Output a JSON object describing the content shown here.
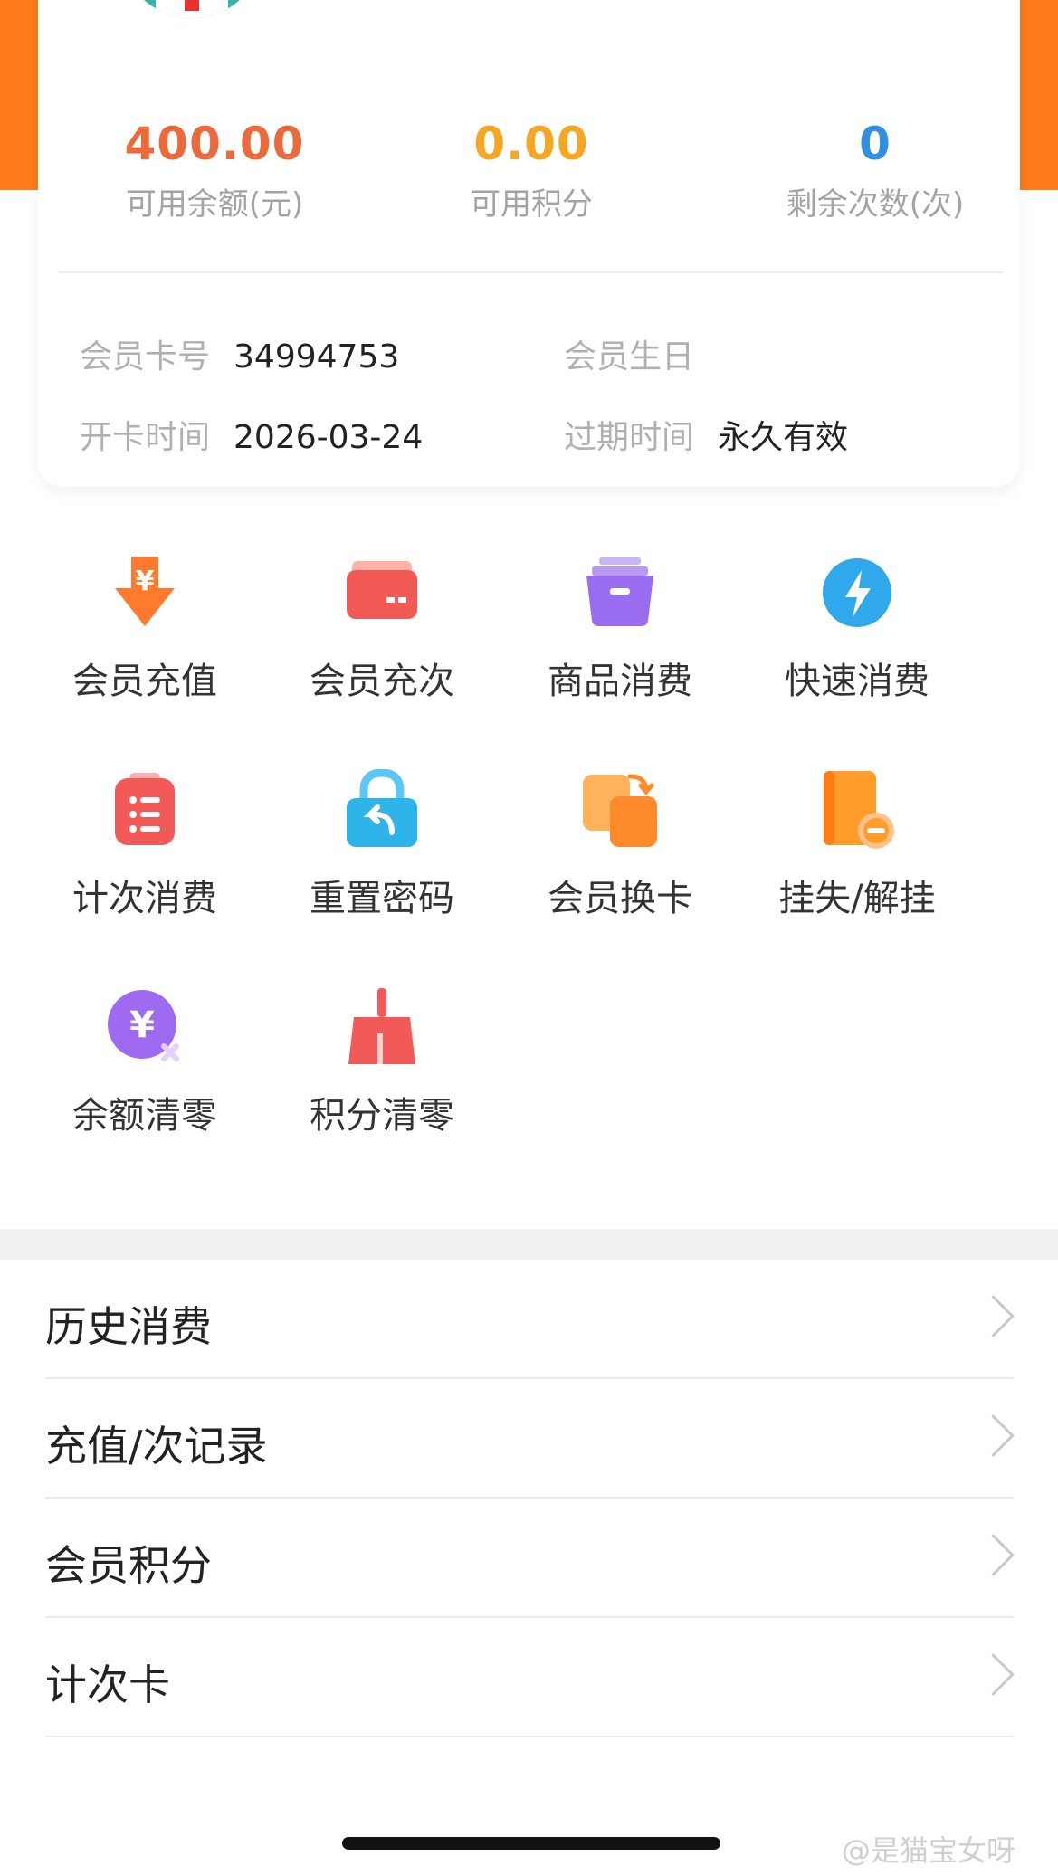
{
  "stats": {
    "balance": {
      "value": "400.00",
      "label": "可用余额(元)"
    },
    "points": {
      "value": "0.00",
      "label": "可用积分"
    },
    "remaining": {
      "value": "0",
      "label": "剩余次数(次)"
    }
  },
  "member_info": {
    "card_no_label": "会员卡号",
    "card_no": "34994753",
    "birthday_label": "会员生日",
    "birthday": "",
    "open_time_label": "开卡时间",
    "open_time": "2026-03-24",
    "expire_label": "过期时间",
    "expire": "永久有效"
  },
  "actions": [
    {
      "label": "会员充值",
      "icon": "yuan-down-arrow-icon"
    },
    {
      "label": "会员充次",
      "icon": "card-icon"
    },
    {
      "label": "商品消费",
      "icon": "basket-icon"
    },
    {
      "label": "快速消费",
      "icon": "lightning-icon"
    },
    {
      "label": "计次消费",
      "icon": "checklist-icon"
    },
    {
      "label": "重置密码",
      "icon": "lock-reset-icon"
    },
    {
      "label": "会员换卡",
      "icon": "swap-card-icon"
    },
    {
      "label": "挂失/解挂",
      "icon": "book-minus-icon"
    },
    {
      "label": "余额清零",
      "icon": "yuan-clear-icon"
    },
    {
      "label": "积分清零",
      "icon": "broom-icon"
    }
  ],
  "list": [
    {
      "label": "历史消费"
    },
    {
      "label": "充值/次记录"
    },
    {
      "label": "会员积分"
    },
    {
      "label": "计次卡"
    }
  ],
  "watermark": "@是猫宝女呀",
  "colors": {
    "balance": "#ea6a3c",
    "points": "#f5a623",
    "remaining": "#2f8fe0",
    "header": "#ff7a1a"
  }
}
